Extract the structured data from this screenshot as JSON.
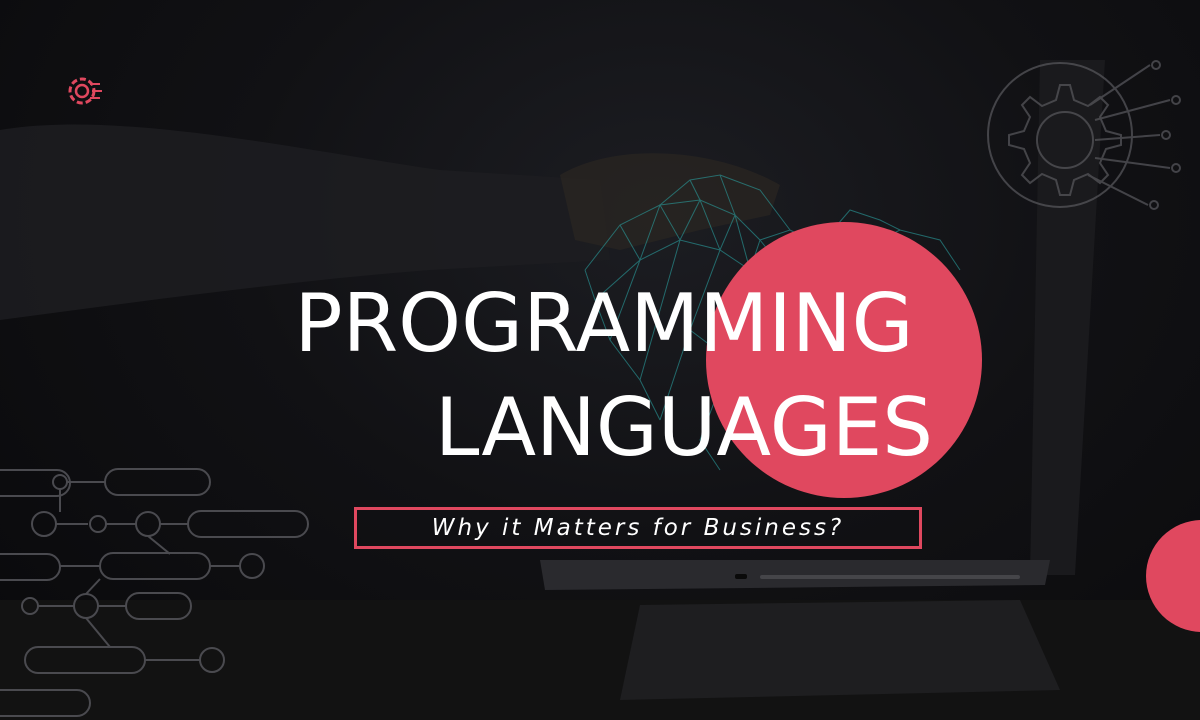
{
  "banner": {
    "title_line1": "PROGRAMMING",
    "title_line2": "LANGUAGES",
    "subtitle": "Why it Matters for Business?"
  },
  "colors": {
    "accent": "#e0485f",
    "text": "#ffffff",
    "background": "#0c0c0e",
    "circuit": "#4a4a4f",
    "mesh": "#2aa0a0"
  },
  "icons": {
    "logo": "gear-c-logo-icon",
    "top_right": "gear-circuit-icon",
    "left_decoration": "circuit-network-pattern"
  }
}
